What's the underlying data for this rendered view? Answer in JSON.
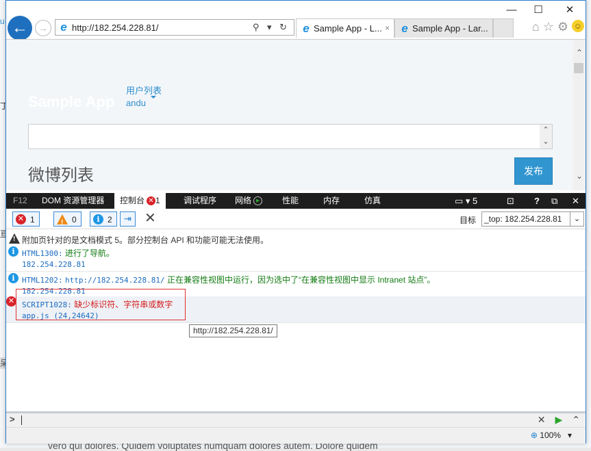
{
  "background": {
    "bottom_text": "vero qui dolores. Quidem voluptates numquam dolores autem. Dolore quidem",
    "left_fragments": [
      "u",
      "丁",
      "亘",
      "呆"
    ]
  },
  "window": {
    "controls": {
      "minimize": "—",
      "maximize": "☐",
      "close": "✕"
    }
  },
  "navbar": {
    "back_icon": "←",
    "forward_icon": "→",
    "address": "http://182.254.228.81/",
    "address_tools": "⚲ ▾ ↻",
    "tabs": [
      {
        "label": "Sample App - L...",
        "close": "×",
        "active": true
      },
      {
        "label": "Sample App - Lar...",
        "active": false
      }
    ],
    "right_icons": {
      "home": "⌂",
      "favorites": "☆",
      "settings": "⚙",
      "feedback": "☺"
    }
  },
  "page": {
    "brand": "Sample App",
    "nav_link": "用户列表",
    "user_link": "andu",
    "post_input_value": "",
    "list_title": "微博列表",
    "publish_button": "发布"
  },
  "devtools": {
    "tabs": [
      {
        "label": "F12"
      },
      {
        "label": "DOM 资源管理器"
      },
      {
        "label": "控制台",
        "badge": "1",
        "active": true
      },
      {
        "label": "调试程序"
      },
      {
        "label": "网络"
      },
      {
        "label": "性能"
      },
      {
        "label": "内存"
      },
      {
        "label": "仿真"
      }
    ],
    "right": {
      "emulation_count": "5",
      "console_icon": "⊡",
      "help": "?",
      "undock": "⧉",
      "close": "✕"
    },
    "filters": {
      "errors": "1",
      "warnings": "0",
      "messages": "2"
    },
    "target_label": "目标",
    "target_value": "_top: 182.254.228.81",
    "messages": [
      {
        "type": "warning",
        "text": "附加页针对的是文档模式 5。部分控制台 API 和功能可能无法使用。"
      },
      {
        "type": "info",
        "code": "HTML1300:",
        "text": "进行了导航。",
        "source": "182.254.228.81"
      },
      {
        "type": "info",
        "code": "HTML1202:",
        "url": "http://182.254.228.81/",
        "text": "正在兼容性视图中运行，因为选中了“在兼容性视图中显示 Intranet 站点”。",
        "source": "182.254.228.81"
      },
      {
        "type": "error",
        "code": "SCRIPT1028:",
        "text": "缺少标识符、字符串或数字",
        "source": "app.js (24,24642)"
      }
    ],
    "tooltip": "http://182.254.228.81/",
    "input_prompt": ">",
    "input_value": "",
    "zoom": "100%"
  }
}
